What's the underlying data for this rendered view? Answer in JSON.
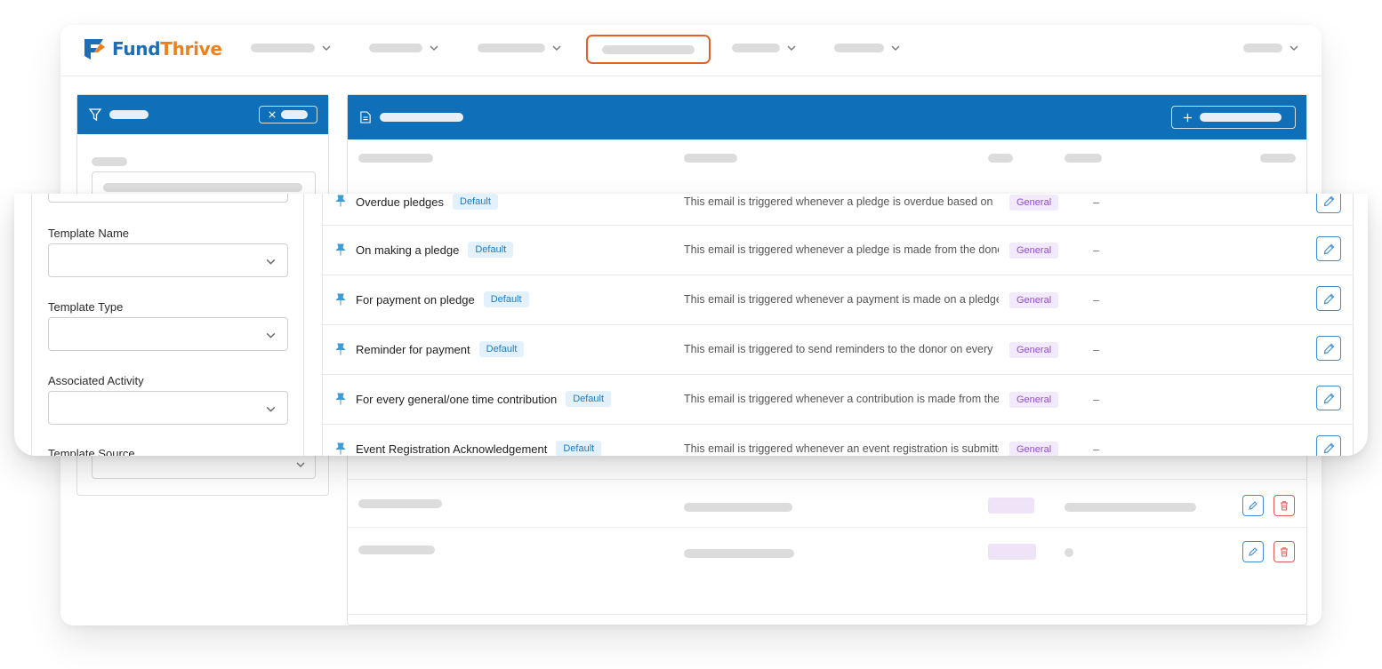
{
  "brand": {
    "name_part1": "Fund",
    "name_part2": "Thrive"
  },
  "filters": {
    "fields": [
      {
        "label": "Template Name",
        "value": ""
      },
      {
        "label": "Template Type",
        "value": ""
      },
      {
        "label": "Associated Activity",
        "value": ""
      },
      {
        "label": "Template Source",
        "value": ""
      }
    ]
  },
  "templates": [
    {
      "name": "Overdue pledges",
      "badge": "Default",
      "description": "This email is triggered whenever a pledge is overdue based on",
      "category": "General",
      "extra": "–"
    },
    {
      "name": "On making a pledge",
      "badge": "Default",
      "description": "This email is triggered whenever a pledge is made from the donor",
      "category": "General",
      "extra": "–"
    },
    {
      "name": "For payment on pledge",
      "badge": "Default",
      "description": "This email is triggered whenever a payment is made on a pledge",
      "category": "General",
      "extra": "–"
    },
    {
      "name": "Reminder for payment",
      "badge": "Default",
      "description": "This email is triggered to send reminders to the donor on every",
      "category": "General",
      "extra": "–"
    },
    {
      "name": "For every general/one time contribution",
      "badge": "Default",
      "description": "This email is triggered whenever a contribution is made from the",
      "category": "General",
      "extra": "–"
    },
    {
      "name": "Event Registration Acknowledgement",
      "badge": "Default",
      "description": "This email is triggered whenever an event registration is submitted",
      "category": "General",
      "extra": "–"
    }
  ],
  "icons": {
    "pin": "pin-icon",
    "edit": "pencil-icon",
    "delete": "trash-icon",
    "filter": "funnel-icon",
    "document": "document-icon",
    "add": "plus-icon",
    "close": "close-icon",
    "dropdown": "chevron-down-icon"
  },
  "colors": {
    "primary": "#0f6fb8",
    "brand_blue": "#1f6db5",
    "brand_orange": "#ef7f1a",
    "active_nav": "#e2622b",
    "default_badge": "#1d7ac9",
    "general_badge": "#8b52c5",
    "danger": "#e05a5a"
  }
}
